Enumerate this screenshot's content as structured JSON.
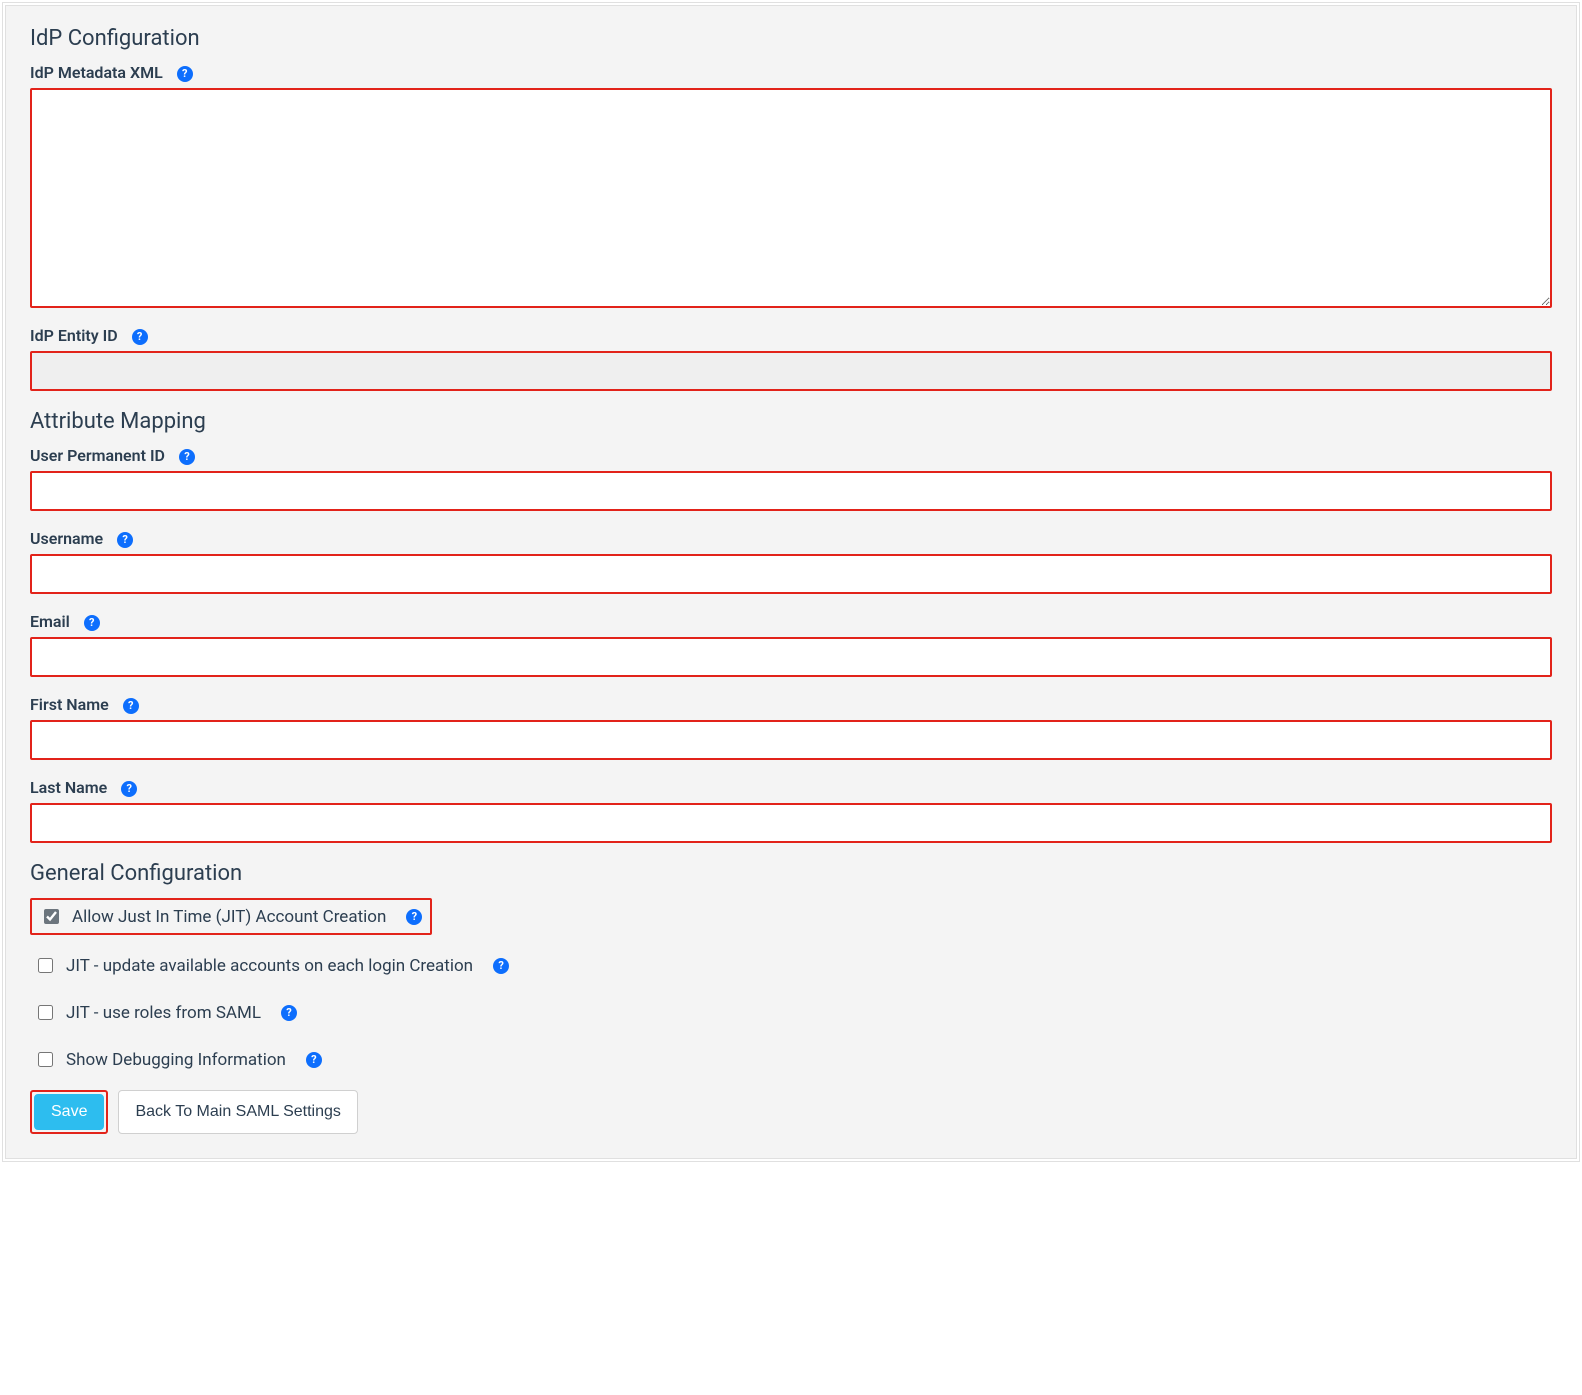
{
  "sections": {
    "idp": {
      "title": "IdP Configuration",
      "metadata_label": "IdP Metadata XML",
      "metadata_value": "",
      "entity_label": "IdP Entity ID",
      "entity_value": ""
    },
    "attr": {
      "title": "Attribute Mapping",
      "user_perm_label": "User Permanent ID",
      "user_perm_value": "",
      "username_label": "Username",
      "username_value": "",
      "email_label": "Email",
      "email_value": "",
      "first_name_label": "First Name",
      "first_name_value": "",
      "last_name_label": "Last Name",
      "last_name_value": ""
    },
    "general": {
      "title": "General Configuration",
      "jit_allow_label": "Allow Just In Time (JIT) Account Creation",
      "jit_allow_checked": true,
      "jit_update_label": "JIT - update available accounts on each login Creation",
      "jit_update_checked": false,
      "jit_roles_label": "JIT - use roles from SAML",
      "jit_roles_checked": false,
      "debug_label": "Show Debugging Information",
      "debug_checked": false
    },
    "buttons": {
      "save": "Save",
      "back": "Back To Main SAML Settings"
    }
  },
  "icons": {
    "help_glyph": "?"
  }
}
